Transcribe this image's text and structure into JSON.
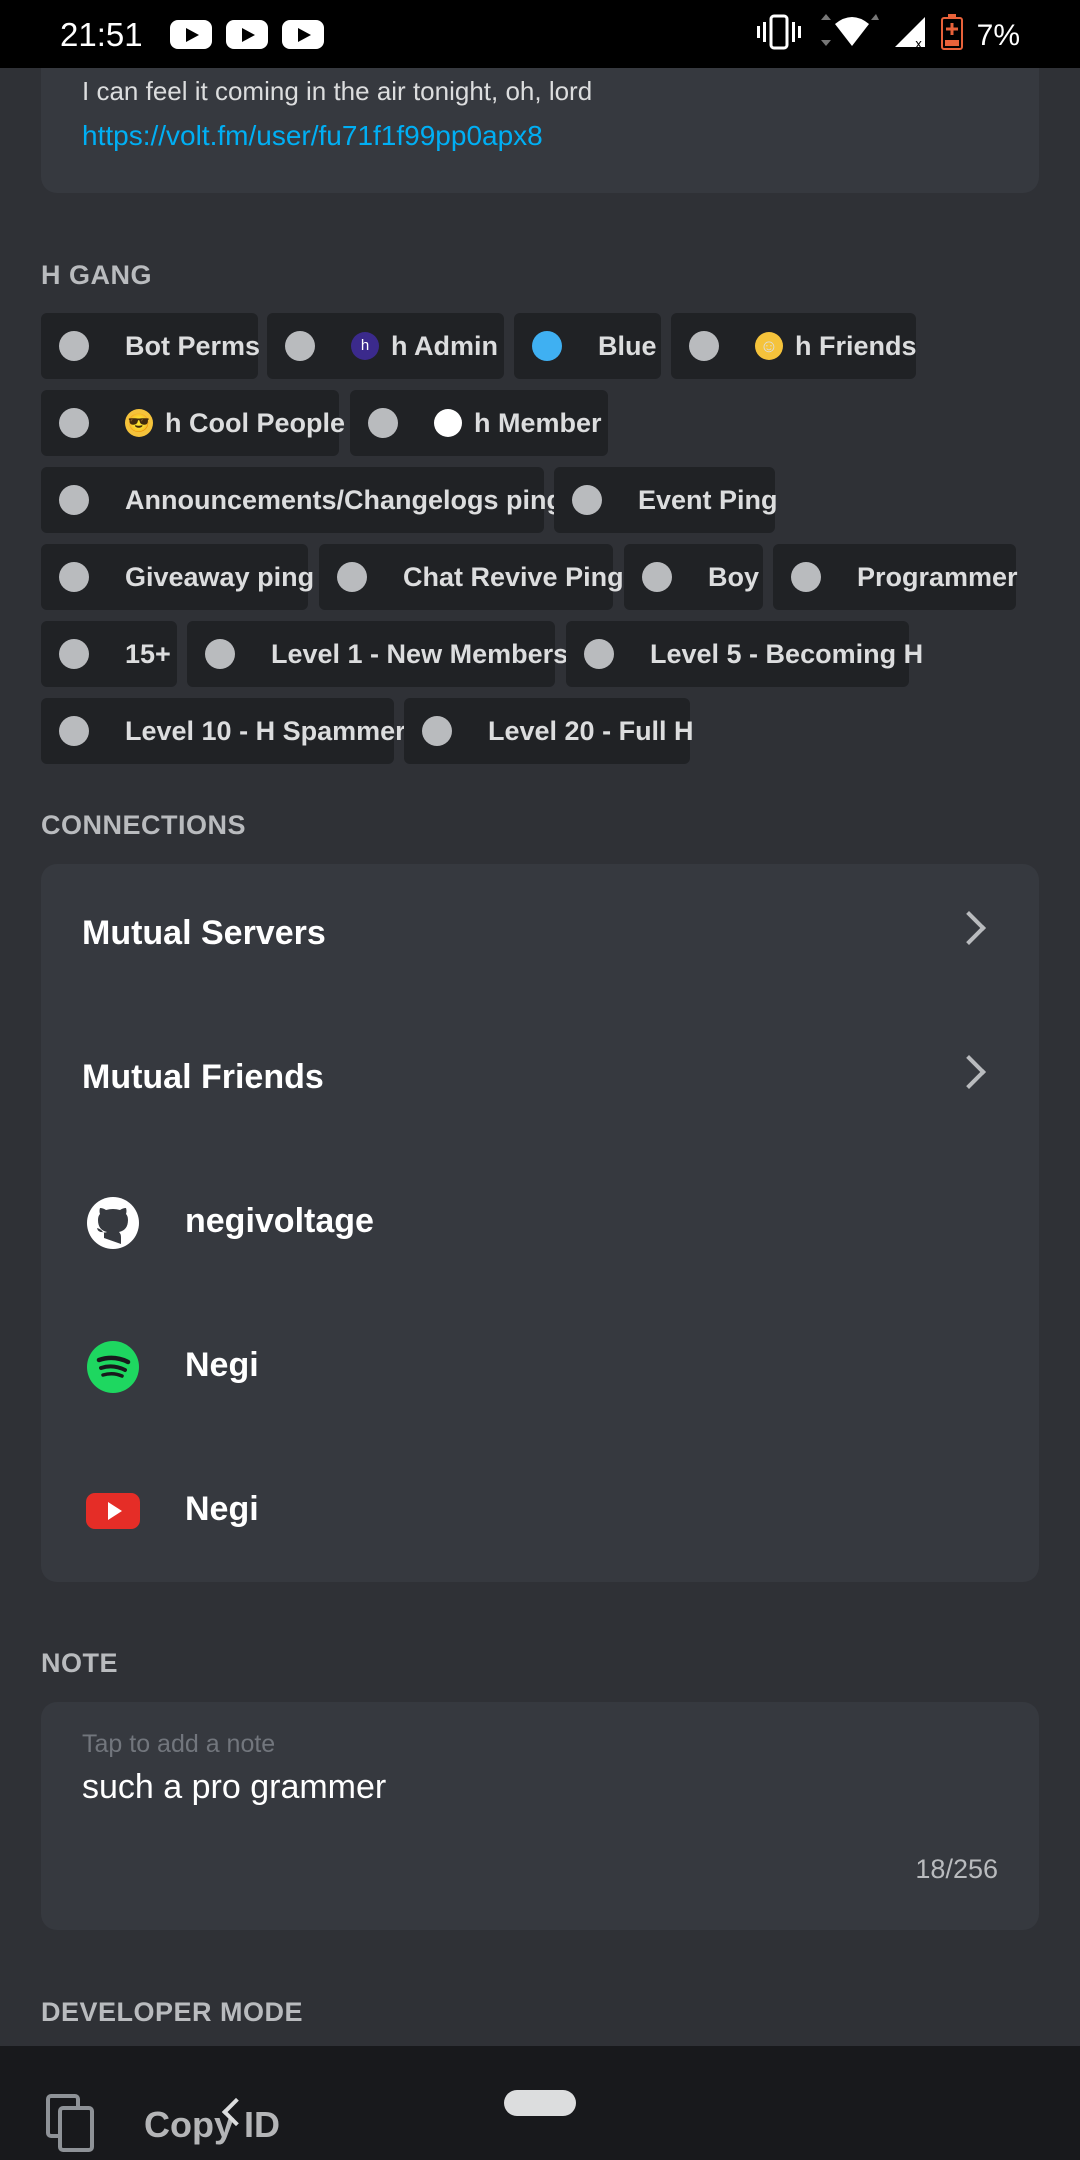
{
  "status_bar": {
    "time": "21:51",
    "battery": "7%",
    "icons": [
      "youtube-icon",
      "youtube-icon",
      "youtube-icon",
      "vibrate-icon",
      "wifi-icon",
      "signal-icon",
      "battery-icon"
    ]
  },
  "bio": {
    "text": "I can feel it coming in the air tonight, oh, lord",
    "link": "https://volt.fm/user/fu71f1f99pp0apx8",
    "link_color": "#00aff4"
  },
  "roles_section": {
    "title": "H GANG",
    "roles": [
      {
        "label": "Bot Perms",
        "color": "#b9bbbe"
      },
      {
        "label": "h Admin",
        "color": "#b9bbbe",
        "emoji": "h-badge-emoji"
      },
      {
        "label": "Blue",
        "color": "#3fb0f2"
      },
      {
        "label": "h Friends",
        "color": "#b9bbbe",
        "emoji": "smiley-emoji"
      },
      {
        "label": "h Cool People",
        "color": "#b9bbbe",
        "emoji": "sunglasses-emoji"
      },
      {
        "label": "h Member",
        "color": "#b9bbbe",
        "emoji": "white-face-emoji"
      },
      {
        "label": "Announcements/Changelogs ping",
        "color": "#b9bbbe"
      },
      {
        "label": "Event Ping",
        "color": "#b9bbbe"
      },
      {
        "label": "Giveaway ping",
        "color": "#b9bbbe"
      },
      {
        "label": "Chat Revive Ping",
        "color": "#b9bbbe"
      },
      {
        "label": "Boy",
        "color": "#b9bbbe"
      },
      {
        "label": "Programmer",
        "color": "#b9bbbe"
      },
      {
        "label": "15+",
        "color": "#b9bbbe"
      },
      {
        "label": "Level 1 - New Members",
        "color": "#b9bbbe"
      },
      {
        "label": "Level 5 - Becoming H",
        "color": "#b9bbbe"
      },
      {
        "label": "Level 10 - H Spammer",
        "color": "#b9bbbe"
      },
      {
        "label": "Level 20 - Full H",
        "color": "#b9bbbe"
      }
    ]
  },
  "connections": {
    "title": "CONNECTIONS",
    "mutual_servers": "Mutual Servers",
    "mutual_friends": "Mutual Friends",
    "accounts": [
      {
        "service": "github",
        "icon": "github-icon",
        "name": "negivoltage"
      },
      {
        "service": "spotify",
        "icon": "spotify-icon",
        "name": "Negi"
      },
      {
        "service": "youtube",
        "icon": "youtube-icon",
        "name": "Negi"
      }
    ]
  },
  "note": {
    "title": "NOTE",
    "placeholder": "Tap to add a note",
    "value": "such a pro grammer",
    "count": "18/256"
  },
  "developer_mode": {
    "title": "DEVELOPER MODE",
    "copy_id_label": "Copy ID"
  },
  "colors": {
    "background": "#2f3136",
    "card": "#36393f",
    "role_chip": "#202225",
    "spotify": "#1ed760",
    "youtube": "#e52d27"
  }
}
